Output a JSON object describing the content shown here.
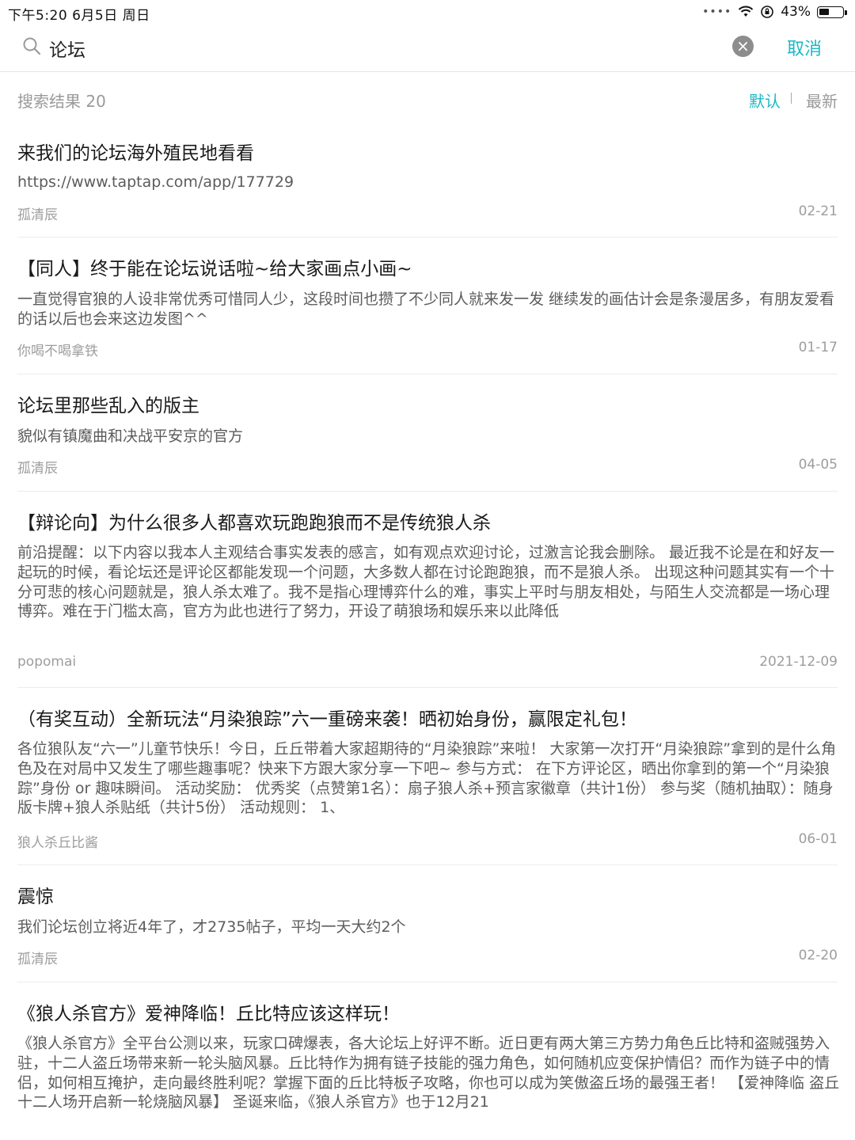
{
  "status": {
    "time_date": "下午5:20   6月5日 周日",
    "battery": "43%",
    "battery_level": 0.43
  },
  "search": {
    "query": "论坛",
    "cancel_label": "取消"
  },
  "results": {
    "count_label": "搜索结果 20",
    "sort_default": "默认",
    "sort_latest": "最新"
  },
  "items": [
    {
      "title": "来我们的论坛海外殖民地看看",
      "body": "https://www.taptap.com/app/177729",
      "author": "孤清辰",
      "date": "02-21"
    },
    {
      "title": "【同人】终于能在论坛说话啦~给大家画点小画~",
      "body": "一直觉得官狼的人设非常优秀可惜同人少，这段时间也攒了不少同人就来发一发 继续发的画估计会是条漫居多，有朋友爱看的话以后也会来这边发图^^",
      "author": "你喝不喝拿铁",
      "date": "01-17"
    },
    {
      "title": "论坛里那些乱入的版主",
      "body": "貌似有镇魔曲和决战平安京的官方",
      "author": "孤清辰",
      "date": "04-05"
    },
    {
      "title": "【辩论向】为什么很多人都喜欢玩跑跑狼而不是传统狼人杀",
      "body": "前沿提醒：以下内容以我本人主观结合事实发表的感言，如有观点欢迎讨论，过激言论我会删除。 最近我不论是在和好友一起玩的时候，看论坛还是评论区都能发现一个问题，大多数人都在讨论跑跑狼，而不是狼人杀。 出现这种问题其实有一个十分可悲的核心问题就是，狼人杀太难了。我不是指心理博弈什么的难，事实上平时与朋友相处，与陌生人交流都是一场心理博弈。难在于门槛太高，官方为此也进行了努力，开设了萌狼场和娱乐来以此降低",
      "author": "popomai",
      "date": "2021-12-09"
    },
    {
      "title": "（有奖互动）全新玩法“月染狼踪”六一重磅来袭！晒初始身份，赢限定礼包！",
      "body": "各位狼队友“六一”儿童节快乐！今日，丘丘带着大家超期待的“月染狼踪”来啦！ 大家第一次打开“月染狼踪”拿到的是什么角色及在对局中又发生了哪些趣事呢？快来下方跟大家分享一下吧~ 参与方式： 在下方评论区，晒出你拿到的第一个“月染狼踪”身份 or 趣味瞬间。 活动奖励： 优秀奖（点赞第1名）：扇子狼人杀+预言家徽章（共计1份） 参与奖（随机抽取）：随身版卡牌+狼人杀贴纸（共计5份） 活动规则： 1、",
      "author": "狼人杀丘比酱",
      "date": "06-01"
    },
    {
      "title": "震惊",
      "body": "我们论坛创立将近4年了，才2735帖子，平均一天大约2个",
      "author": "孤清辰",
      "date": "02-20"
    },
    {
      "title": "《狼人杀官方》爱神降临！丘比特应该这样玩！",
      "body": "《狼人杀官方》全平台公测以来，玩家口碑爆表，各大论坛上好评不断。近日更有两大第三方势力角色丘比特和盗贼强势入驻，十二人盗丘场带来新一轮头脑风暴。丘比特作为拥有链子技能的强力角色，如何随机应变保护情侣？而作为链子中的情侣，如何相互掩护，走向最终胜利呢？掌握下面的丘比特板子攻略，你也可以成为笑傲盗丘场的最强王者！ 【爱神降临 盗丘十二人场开启新一轮烧脑风暴】 圣诞来临，《狼人杀官方》也于12月21",
      "author": "",
      "date": ""
    }
  ]
}
